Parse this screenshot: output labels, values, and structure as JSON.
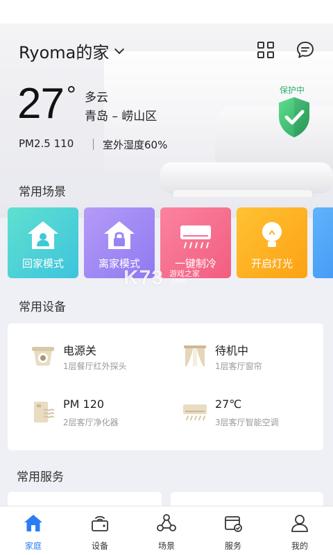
{
  "header": {
    "home_name": "Ryoma的家",
    "icons": [
      "grid-icon",
      "chat-icon",
      "chevron-down-icon"
    ]
  },
  "weather": {
    "temperature": "27",
    "degree_symbol": "°",
    "condition": "多云",
    "location": "青岛 – 崂山区",
    "pm25": "PM2.5 110",
    "humidity": "室外湿度60%"
  },
  "protection": {
    "label": "保护中",
    "color": "#2fb26b"
  },
  "scenes": {
    "title": "常用场景",
    "items": [
      {
        "label": "回家模式",
        "icon": "home-user-icon",
        "color": "#4fd3d0"
      },
      {
        "label": "离家模式",
        "icon": "home-lock-icon",
        "color": "#a98af5"
      },
      {
        "label": "一键制冷",
        "icon": "air-conditioner-icon",
        "color": "#f66f8e"
      },
      {
        "label": "开启灯光",
        "icon": "light-bulb-icon",
        "color": "#fdb21c"
      },
      {
        "label": "",
        "icon": "",
        "color": "#4aa2f7"
      }
    ]
  },
  "devices": {
    "title": "常用设备",
    "items": [
      {
        "name": "电源关",
        "location": "1层餐厅红外探头",
        "icon": "camera-sensor-icon"
      },
      {
        "name": "待机中",
        "location": "1层客厅窗帘",
        "icon": "curtain-icon"
      },
      {
        "name": "PM 120",
        "location": "2层客厅净化器",
        "icon": "air-purifier-icon"
      },
      {
        "name": "27℃",
        "location": "3层客厅智能空调",
        "icon": "air-conditioner-icon"
      }
    ]
  },
  "services": {
    "title": "常用服务"
  },
  "tabbar": {
    "active_color": "#2c7cf6",
    "items": [
      {
        "label": "家庭",
        "icon": "home-icon",
        "active": true
      },
      {
        "label": "设备",
        "icon": "device-icon",
        "active": false
      },
      {
        "label": "场景",
        "icon": "scene-icon",
        "active": false
      },
      {
        "label": "服务",
        "icon": "service-icon",
        "active": false
      },
      {
        "label": "我的",
        "icon": "profile-icon",
        "active": false
      }
    ]
  },
  "watermark": {
    "logo": "K73",
    "text": "游戏之家",
    "url": ".com"
  }
}
